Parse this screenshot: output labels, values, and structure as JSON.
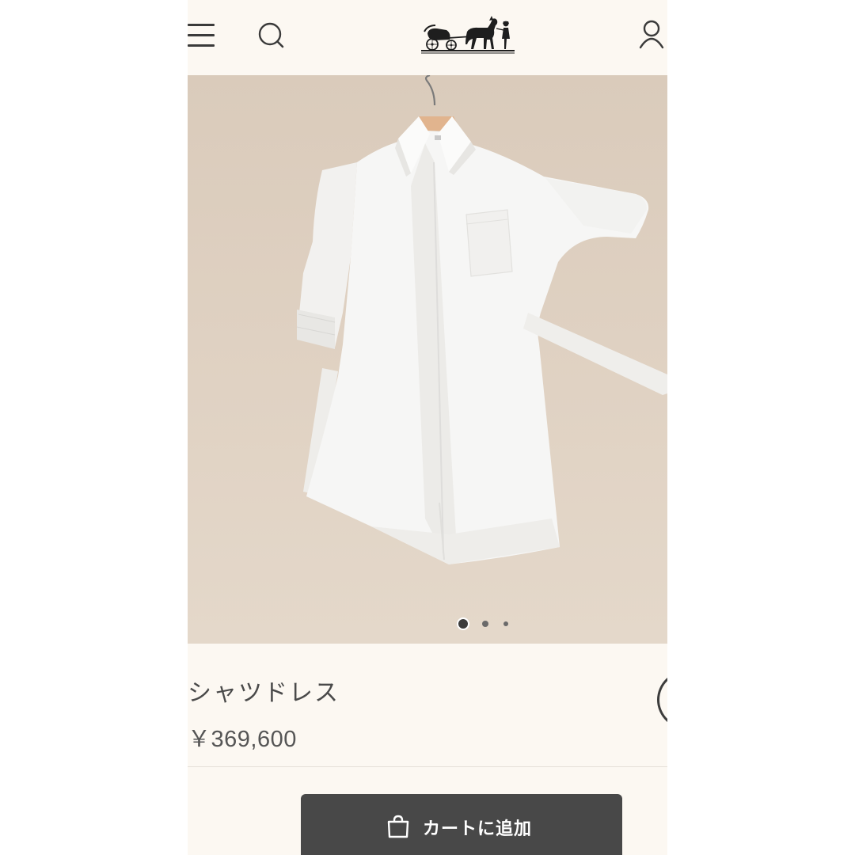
{
  "header": {
    "menu_icon": "hamburger-menu-icon",
    "search_icon": "search-icon",
    "logo_icon": "carriage-logo-icon",
    "account_icon": "user-icon"
  },
  "carousel": {
    "slide_count": 3,
    "active_index": 0
  },
  "product": {
    "name": "シャツドレス",
    "price": "￥369,600",
    "favorite_icon": "heart-icon"
  },
  "actions": {
    "add_to_cart_label": "カートに追加",
    "add_to_cart_icon": "shopping-bag-icon",
    "button_color": "#484848"
  },
  "colors": {
    "background": "#fcf8f2",
    "image_background": "#dccdbd",
    "text": "#4a4a4a"
  }
}
